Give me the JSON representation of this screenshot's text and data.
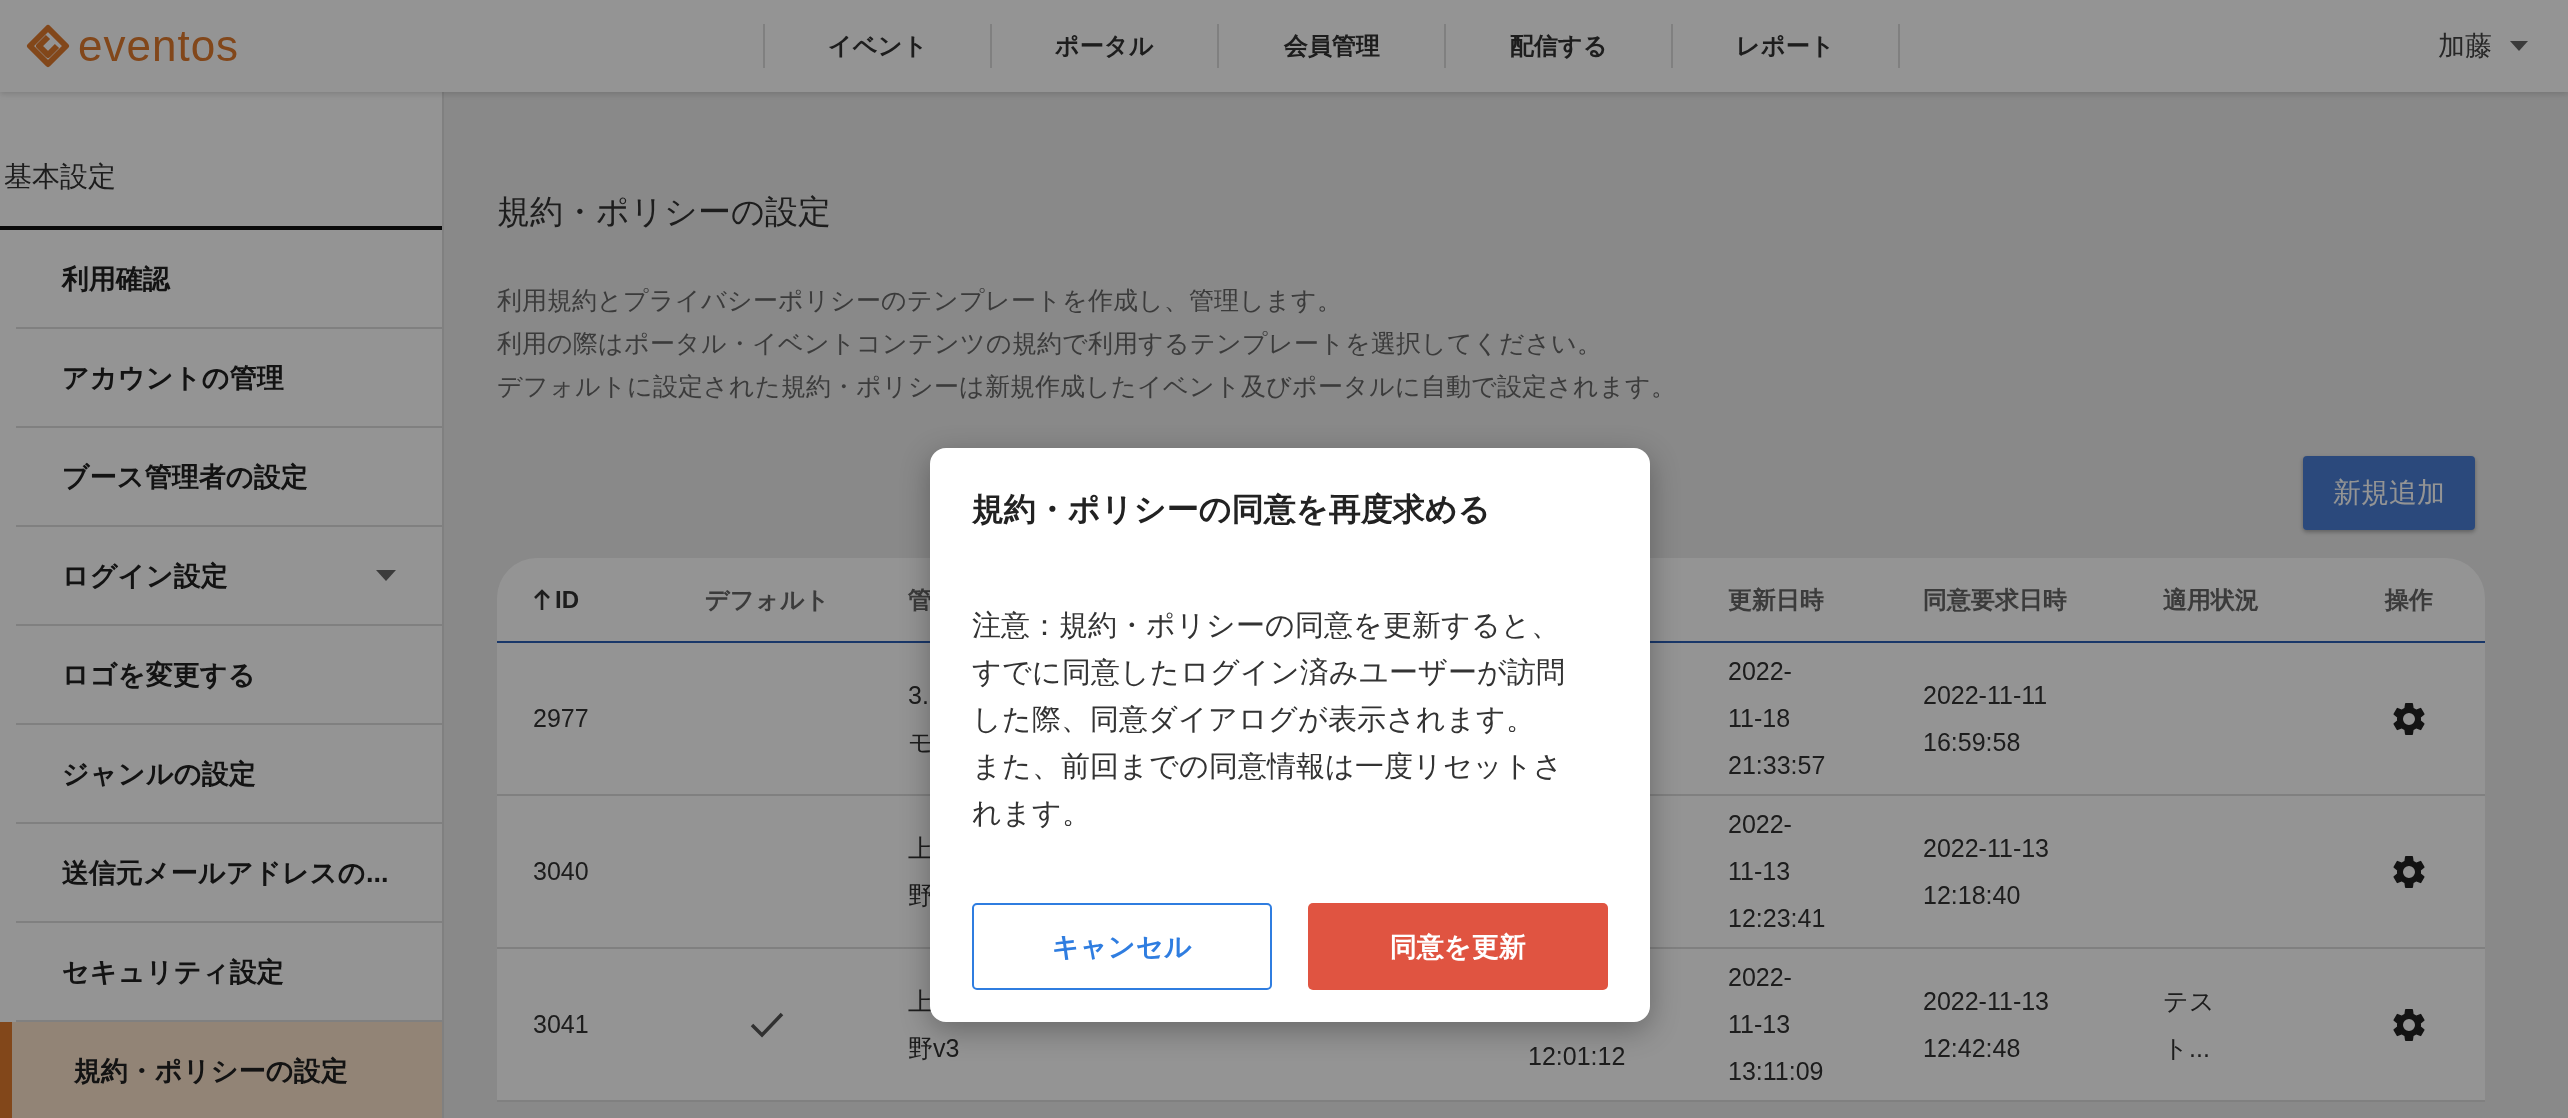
{
  "header": {
    "logo": "eventos",
    "nav": [
      {
        "label": "イベント"
      },
      {
        "label": "ポータル"
      },
      {
        "label": "会員管理"
      },
      {
        "label": "配信する"
      },
      {
        "label": "レポート"
      }
    ],
    "user": "加藤"
  },
  "sidebar": {
    "section": "基本設定",
    "items": [
      {
        "label": "利用確認",
        "selected": false,
        "expandable": false
      },
      {
        "label": "アカウントの管理",
        "selected": false,
        "expandable": false
      },
      {
        "label": "ブース管理者の設定",
        "selected": false,
        "expandable": false
      },
      {
        "label": "ログイン設定",
        "selected": false,
        "expandable": true
      },
      {
        "label": "ロゴを変更する",
        "selected": false,
        "expandable": false
      },
      {
        "label": "ジャンルの設定",
        "selected": false,
        "expandable": false
      },
      {
        "label": "送信元メールアドレスの...",
        "selected": false,
        "expandable": false
      },
      {
        "label": "セキュリティ設定",
        "selected": false,
        "expandable": false
      },
      {
        "label": "規約・ポリシーの設定",
        "selected": true,
        "expandable": false
      }
    ]
  },
  "page": {
    "title": "規約・ポリシーの設定",
    "description": [
      "利用規約とプライバシーポリシーのテンプレートを作成し、管理します。",
      "利用の際はポータル・イベントコンテンツの規約で利用するテンプレートを選択してください。",
      "デフォルトに設定された規約・ポリシーは新規作成したイベント及びポータルに自動で設定されます。"
    ],
    "add_button": "新規追加"
  },
  "table": {
    "columns": [
      {
        "label": "ID",
        "sorted": true
      },
      {
        "label": "デフォルト",
        "sorted": false
      },
      {
        "label": "管",
        "sorted": false
      },
      {
        "label": "更新日時",
        "sorted": false
      },
      {
        "label": "同意要求日時",
        "sorted": false
      },
      {
        "label": "適用状況",
        "sorted": false
      },
      {
        "label": "操作",
        "sorted": false
      }
    ],
    "rows": [
      {
        "id": "2977",
        "default": false,
        "column_3": [
          "3.",
          "モ"
        ],
        "updated": [
          "2022-",
          "11-18",
          "21:33:57"
        ],
        "consent_requested": [
          "2022-11-11",
          "16:59:58"
        ]
      },
      {
        "id": "3040",
        "default": false,
        "column_3": [
          "上",
          "野"
        ],
        "updated": [
          "2022-",
          "11-13",
          "12:23:41"
        ],
        "consent_requested": [
          "2022-11-13",
          "12:18:40"
        ]
      },
      {
        "id": "3041",
        "default": true,
        "column_3": [
          "上",
          "野v3"
        ],
        "column_6": [
          "12:01:12"
        ],
        "updated": [
          "2022-",
          "11-13",
          "13:11:09"
        ],
        "consent_requested": [
          "2022-11-13",
          "12:42:48"
        ],
        "status": [
          "テス",
          "ト..."
        ]
      }
    ]
  },
  "dialog": {
    "title": "規約・ポリシーの同意を再度求める",
    "body": [
      "注意：規約・ポリシーの同意を更新すると、すでに同意したログイン済みユーザーが訪問した際、同意ダイアログが表示されます。",
      "また、前回までの同意情報は一度リセットされます。"
    ],
    "cancel": "キャンセル",
    "confirm": "同意を更新"
  }
}
